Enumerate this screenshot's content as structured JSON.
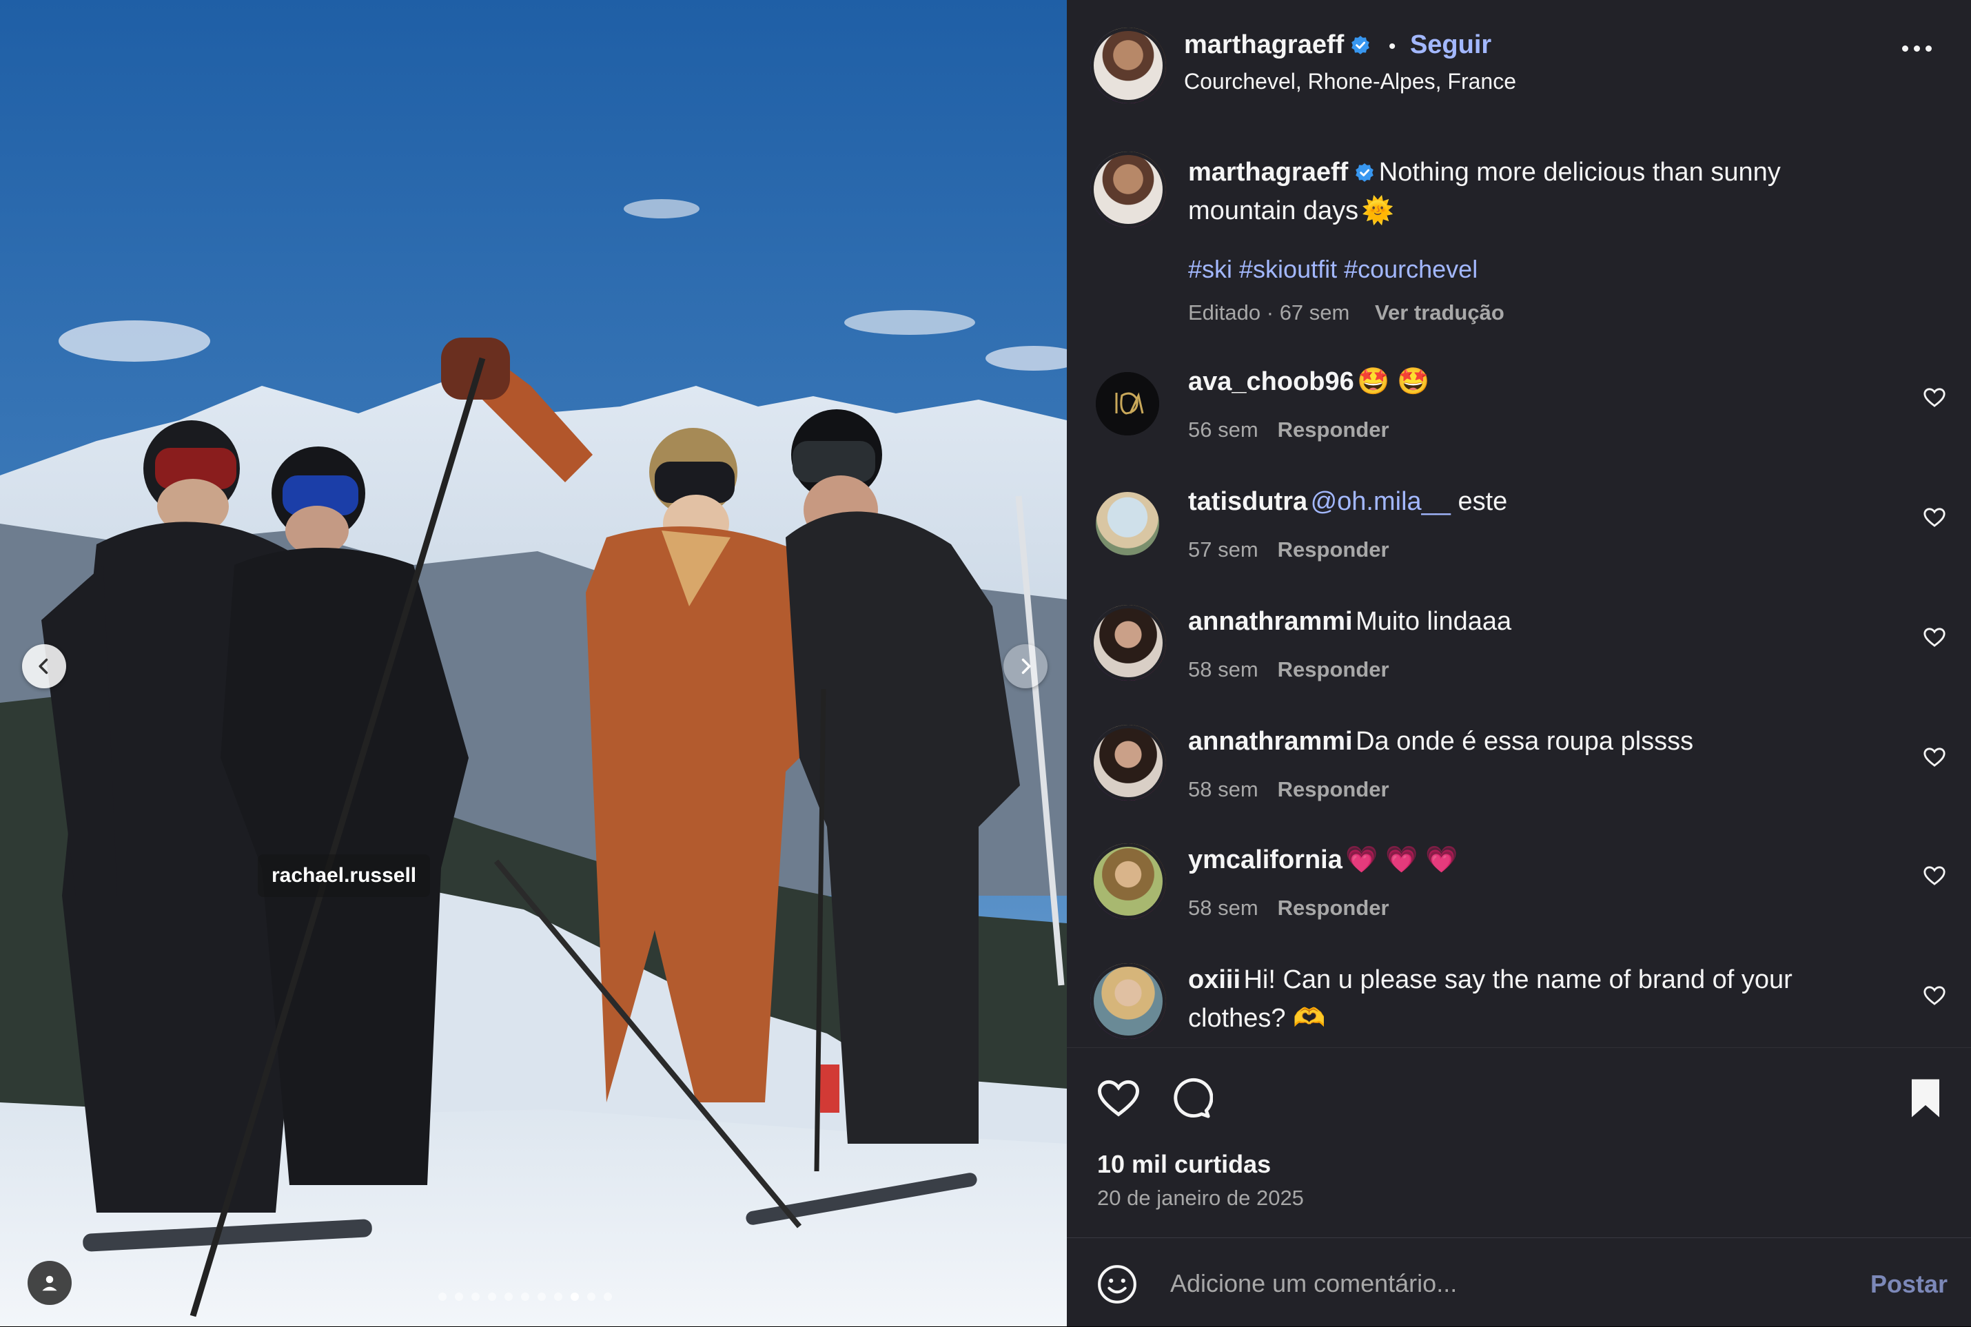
{
  "photo": {
    "tag_label": "rachael.russell",
    "carousel_total": 11,
    "carousel_active": 9
  },
  "post": {
    "author": "marthagraeff",
    "separator": "•",
    "follow_label": "Seguir",
    "location": "Courchevel, Rhone-Alpes, France",
    "caption_text": "Nothing more delicious than sunny mountain days",
    "caption_emoji": "🌞",
    "hashtags": "#ski #skioutfit #courchevel",
    "edited_meta": "Editado · 67 sem",
    "translate_label": "Ver tradução",
    "likes": "10 mil curtidas",
    "date": "20 de janeiro de 2025"
  },
  "comments": [
    {
      "user": "ava_choob96",
      "mention": "",
      "text": "🤩 🤩",
      "time": "56 sem",
      "reply": "Responder"
    },
    {
      "user": "tatisdutra",
      "mention": "@oh.mila__",
      "text": " este",
      "time": "57 sem",
      "reply": "Responder"
    },
    {
      "user": "annathrammi",
      "mention": "",
      "text": "Muito lindaaa",
      "time": "58 sem",
      "reply": "Responder"
    },
    {
      "user": "annathrammi",
      "mention": "",
      "text": "Da onde é essa roupa plssss",
      "time": "58 sem",
      "reply": "Responder"
    },
    {
      "user": "ymcalifornia",
      "mention": "",
      "text": "💗 💗 💗",
      "time": "58 sem",
      "reply": "Responder"
    },
    {
      "user": "oxiii",
      "mention": "",
      "text": "Hi! Can u please say the name of brand of your clothes? 🫶",
      "time": "",
      "reply": ""
    }
  ],
  "composer": {
    "placeholder": "Adicione um comentário...",
    "post_label": "Postar"
  },
  "icons": [
    "chevron-left-icon",
    "chevron-right-icon",
    "user-tag-icon",
    "verified-icon",
    "more-icon",
    "heart-icon",
    "comment-icon",
    "bookmark-icon",
    "emoji-icon"
  ],
  "colors": {
    "panel_bg": "#222228",
    "link": "#a3b8ff",
    "verified": "#3897f0",
    "muted": "#a8a8a8"
  }
}
